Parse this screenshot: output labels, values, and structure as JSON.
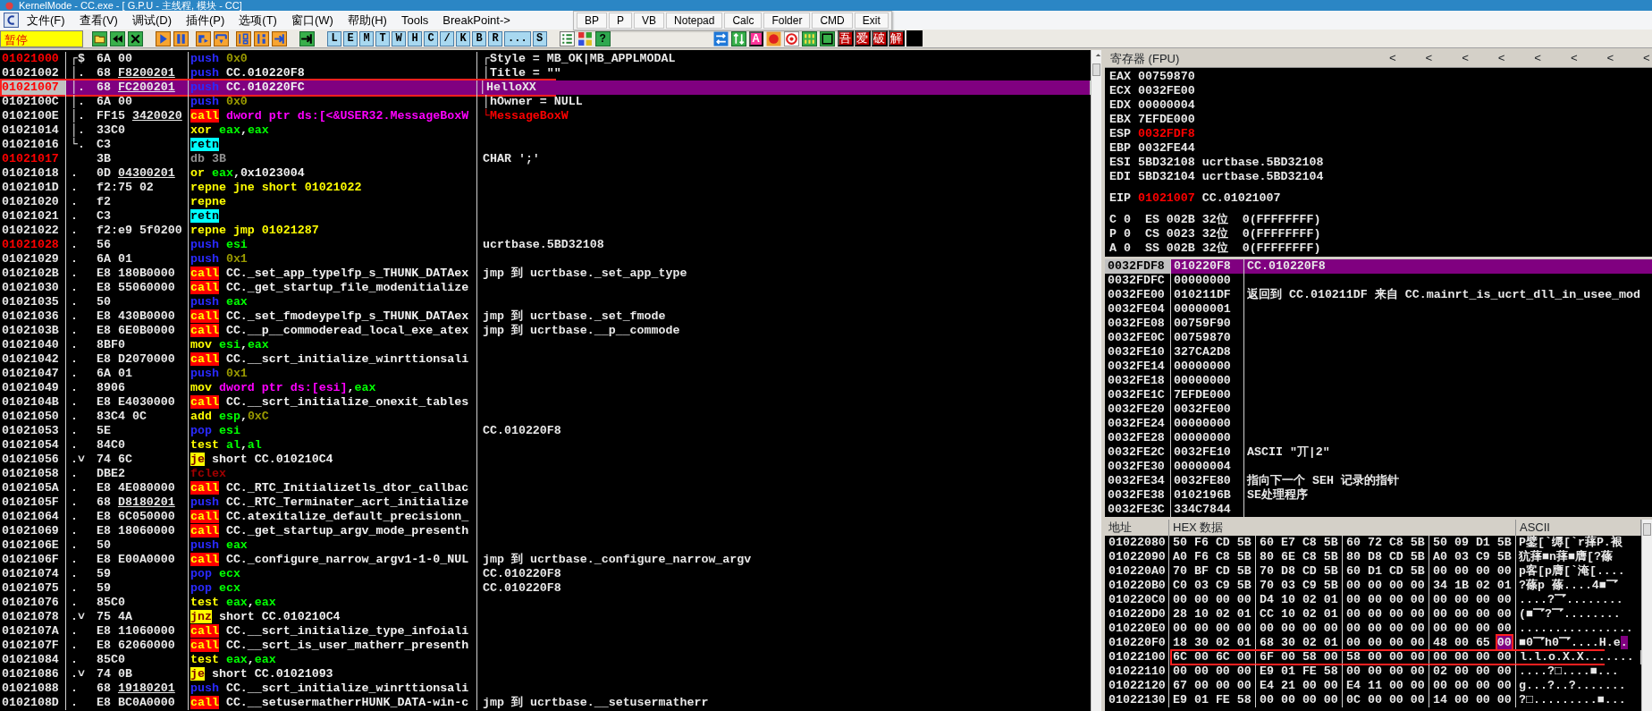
{
  "window": {
    "title": "KernelMode - CC.exe - [ G.P.U - 主线程, 模块 - CC]"
  },
  "menu": [
    "文件(F)",
    "查看(V)",
    "调试(D)",
    "插件(P)",
    "选项(T)",
    "窗口(W)",
    "帮助(H)",
    "Tools",
    "BreakPoint->"
  ],
  "quick_launch": [
    "BP",
    "P",
    "VB",
    "Notepad",
    "Calc",
    "Folder",
    "CMD",
    "Exit"
  ],
  "toolbar": {
    "status": "暂停",
    "letters": [
      "L",
      "E",
      "M",
      "T",
      "W",
      "H",
      "C",
      "/",
      "K",
      "B",
      "R",
      "...",
      "S"
    ],
    "help": "?",
    "font_button": "A",
    "brand": [
      "吾",
      "爱",
      "破",
      "解"
    ]
  },
  "disasm": {
    "rows": [
      {
        "address": "01021000",
        "target": true,
        "selected": false,
        "annotated": false,
        "mark": "┌$",
        "hex": "6A 00",
        "tokens": [
          {
            "kind": "push",
            "text": "push"
          },
          {
            "kind": "imm",
            "text": "0x0"
          }
        ],
        "comment": "┌Style = MB_OK|MB_APPLMODAL",
        "api": false
      },
      {
        "address": "01021002",
        "target": false,
        "selected": false,
        "annotated": false,
        "mark": "│.",
        "hex": "68",
        "fixup": "F8200201",
        "tokens": [
          {
            "kind": "push",
            "text": "push"
          },
          {
            "kind": "sym",
            "text": "CC.010220F8"
          }
        ],
        "comment": "│Title = \"\"",
        "api": false
      },
      {
        "address": "01021007",
        "target": true,
        "selected": true,
        "annotated": true,
        "mark": "│.",
        "hex": "68",
        "fixup": "FC200201",
        "tokens": [
          {
            "kind": "push",
            "text": "push"
          },
          {
            "kind": "sym",
            "text": "CC.010220FC"
          }
        ],
        "comment": "│HelloXX",
        "api": false
      },
      {
        "address": "0102100C",
        "target": false,
        "selected": false,
        "annotated": false,
        "mark": "│.",
        "hex": "6A 00",
        "tokens": [
          {
            "kind": "push",
            "text": "push"
          },
          {
            "kind": "imm",
            "text": "0x0"
          }
        ],
        "comment": "│hOwner = NULL",
        "api": false
      },
      {
        "address": "0102100E",
        "target": false,
        "selected": false,
        "annotated": false,
        "mark": "│.",
        "hex": "FF15",
        "fixup": "3420020",
        "tokens": [
          {
            "kind": "call",
            "text": "call"
          },
          {
            "kind": "mem",
            "text": "dword ptr ds:[<&USER32.MessageBoxW"
          }
        ],
        "comment": "└MessageBoxW",
        "api": true
      },
      {
        "address": "01021014",
        "target": false,
        "selected": false,
        "annotated": false,
        "mark": "│.",
        "hex": "33C0",
        "tokens": [
          {
            "kind": "op",
            "text": "xor"
          },
          {
            "kind": "reg",
            "text": "eax"
          },
          {
            "kind": "punct",
            "text": ","
          },
          {
            "kind": "reg",
            "text": "eax"
          }
        ]
      },
      {
        "address": "01021016",
        "target": false,
        "selected": false,
        "annotated": false,
        "mark": "└.",
        "hex": "C3",
        "tokens": [
          {
            "kind": "ret",
            "text": "retn"
          }
        ]
      },
      {
        "address": "01021017",
        "target": true,
        "selected": false,
        "annotated": false,
        "hex": "3B",
        "tokens": [
          {
            "kind": "db",
            "text": "db 3B"
          }
        ],
        "comment": "CHAR ';'",
        "api": false
      },
      {
        "address": "01021018",
        "target": false,
        "selected": false,
        "annotated": false,
        "mark": ".",
        "hex": "0D",
        "fixup": "04300201",
        "tokens": [
          {
            "kind": "op",
            "text": "or"
          },
          {
            "kind": "reg",
            "text": "eax"
          },
          {
            "kind": "sym",
            "text": ",0x1023004"
          }
        ]
      },
      {
        "address": "0102101D",
        "target": false,
        "selected": false,
        "annotated": false,
        "mark": ".",
        "hex": "f2:75 02",
        "tokens": [
          {
            "kind": "op",
            "text": "repne jne short 01021022"
          }
        ]
      },
      {
        "address": "01021020",
        "target": false,
        "selected": false,
        "annotated": false,
        "mark": ".",
        "hex": "f2",
        "tokens": [
          {
            "kind": "op",
            "text": "repne"
          }
        ]
      },
      {
        "address": "01021021",
        "target": false,
        "selected": false,
        "annotated": false,
        "mark": ".",
        "hex": "C3",
        "tokens": [
          {
            "kind": "ret",
            "text": "retn"
          }
        ]
      },
      {
        "address": "01021022",
        "target": false,
        "selected": false,
        "annotated": false,
        "mark": ".",
        "hex": "f2:e9 5f0200",
        "tokens": [
          {
            "kind": "op",
            "text": "repne jmp 01021287"
          }
        ]
      },
      {
        "address": "01021028",
        "target": true,
        "selected": false,
        "annotated": false,
        "mark": ".",
        "hex": "56",
        "tokens": [
          {
            "kind": "push",
            "text": "push"
          },
          {
            "kind": "reg",
            "text": "esi"
          }
        ],
        "comment": "ucrtbase.5BD32108",
        "api": false
      },
      {
        "address": "01021029",
        "target": false,
        "selected": false,
        "annotated": false,
        "mark": ".",
        "hex": "6A 01",
        "tokens": [
          {
            "kind": "push",
            "text": "push"
          },
          {
            "kind": "imm",
            "text": "0x1"
          }
        ]
      },
      {
        "address": "0102102B",
        "target": false,
        "selected": false,
        "annotated": false,
        "mark": ".",
        "hex": "E8 180B0000",
        "tokens": [
          {
            "kind": "call",
            "text": "call"
          },
          {
            "kind": "sym",
            "text": "CC._set_app_typelfp_s_THUNK_DATAex"
          }
        ],
        "comment": "jmp 到 ucrtbase._set_app_type",
        "api": false
      },
      {
        "address": "01021030",
        "target": false,
        "selected": false,
        "annotated": false,
        "mark": ".",
        "hex": "E8 55060000",
        "tokens": [
          {
            "kind": "call",
            "text": "call"
          },
          {
            "kind": "sym",
            "text": "CC._get_startup_file_modenitialize"
          }
        ]
      },
      {
        "address": "01021035",
        "target": false,
        "selected": false,
        "annotated": false,
        "mark": ".",
        "hex": "50",
        "tokens": [
          {
            "kind": "push",
            "text": "push"
          },
          {
            "kind": "reg",
            "text": "eax"
          }
        ]
      },
      {
        "address": "01021036",
        "target": false,
        "selected": false,
        "annotated": false,
        "mark": ".",
        "hex": "E8 430B0000",
        "tokens": [
          {
            "kind": "call",
            "text": "call"
          },
          {
            "kind": "sym",
            "text": "CC._set_fmodeypelfp_s_THUNK_DATAex"
          }
        ],
        "comment": "jmp 到 ucrtbase._set_fmode",
        "api": false
      },
      {
        "address": "0102103B",
        "target": false,
        "selected": false,
        "annotated": false,
        "mark": ".",
        "hex": "E8 6E0B0000",
        "tokens": [
          {
            "kind": "call",
            "text": "call"
          },
          {
            "kind": "sym",
            "text": "CC.__p__commoderead_local_exe_atex"
          }
        ],
        "comment": "jmp 到 ucrtbase.__p__commode",
        "api": false
      },
      {
        "address": "01021040",
        "target": false,
        "selected": false,
        "annotated": false,
        "mark": ".",
        "hex": "8BF0",
        "tokens": [
          {
            "kind": "op",
            "text": "mov"
          },
          {
            "kind": "reg",
            "text": "esi"
          },
          {
            "kind": "punct",
            "text": ","
          },
          {
            "kind": "reg",
            "text": "eax"
          }
        ]
      },
      {
        "address": "01021042",
        "target": false,
        "selected": false,
        "annotated": false,
        "mark": ".",
        "hex": "E8 D2070000",
        "tokens": [
          {
            "kind": "call",
            "text": "call"
          },
          {
            "kind": "sym",
            "text": "CC.__scrt_initialize_winrttionsali"
          }
        ]
      },
      {
        "address": "01021047",
        "target": false,
        "selected": false,
        "annotated": false,
        "mark": ".",
        "hex": "6A 01",
        "tokens": [
          {
            "kind": "push",
            "text": "push"
          },
          {
            "kind": "imm",
            "text": "0x1"
          }
        ]
      },
      {
        "address": "01021049",
        "target": false,
        "selected": false,
        "annotated": false,
        "mark": ".",
        "hex": "8906",
        "tokens": [
          {
            "kind": "op",
            "text": "mov"
          },
          {
            "kind": "mem",
            "text": "dword ptr ds:[esi]"
          },
          {
            "kind": "punct",
            "text": ","
          },
          {
            "kind": "reg",
            "text": "eax"
          }
        ]
      },
      {
        "address": "0102104B",
        "target": false,
        "selected": false,
        "annotated": false,
        "mark": ".",
        "hex": "E8 E4030000",
        "tokens": [
          {
            "kind": "call",
            "text": "call"
          },
          {
            "kind": "sym",
            "text": "CC.__scrt_initialize_onexit_tables"
          }
        ]
      },
      {
        "address": "01021050",
        "target": false,
        "selected": false,
        "annotated": false,
        "mark": ".",
        "hex": "83C4 0C",
        "tokens": [
          {
            "kind": "op",
            "text": "add"
          },
          {
            "kind": "reg",
            "text": "esp"
          },
          {
            "kind": "punct",
            "text": ","
          },
          {
            "kind": "imm",
            "text": "0xC"
          }
        ]
      },
      {
        "address": "01021053",
        "target": false,
        "selected": false,
        "annotated": false,
        "mark": ".",
        "hex": "5E",
        "tokens": [
          {
            "kind": "push",
            "text": "pop"
          },
          {
            "kind": "reg",
            "text": "esi"
          }
        ],
        "comment": "CC.010220F8",
        "api": false
      },
      {
        "address": "01021054",
        "target": false,
        "selected": false,
        "annotated": false,
        "mark": ".",
        "hex": "84C0",
        "tokens": [
          {
            "kind": "op",
            "text": "test"
          },
          {
            "kind": "reg",
            "text": "al"
          },
          {
            "kind": "punct",
            "text": ","
          },
          {
            "kind": "reg",
            "text": "al"
          }
        ]
      },
      {
        "address": "01021056",
        "target": false,
        "selected": false,
        "annotated": false,
        "mark": ".˅",
        "hex": "74 6C",
        "tokens": [
          {
            "kind": "jcc",
            "text": "je"
          },
          {
            "kind": "sym",
            "text": "short CC.010210C4"
          }
        ]
      },
      {
        "address": "01021058",
        "target": false,
        "selected": false,
        "annotated": false,
        "mark": ".",
        "hex": "DBE2",
        "tokens": [
          {
            "kind": "fpu",
            "text": "fclex"
          }
        ]
      },
      {
        "address": "0102105A",
        "target": false,
        "selected": false,
        "annotated": false,
        "mark": ".",
        "hex": "E8 4E080000",
        "tokens": [
          {
            "kind": "call",
            "text": "call"
          },
          {
            "kind": "sym",
            "text": "CC._RTC_Initializetls_dtor_callbac"
          }
        ]
      },
      {
        "address": "0102105F",
        "target": false,
        "selected": false,
        "annotated": false,
        "mark": ".",
        "hex": "68",
        "fixup": "D8180201",
        "tokens": [
          {
            "kind": "push",
            "text": "push"
          },
          {
            "kind": "sym",
            "text": "CC._RTC_Terminater_acrt_initialize"
          }
        ]
      },
      {
        "address": "01021064",
        "target": false,
        "selected": false,
        "annotated": false,
        "mark": ".",
        "hex": "E8 6C050000",
        "tokens": [
          {
            "kind": "call",
            "text": "call"
          },
          {
            "kind": "sym",
            "text": "CC.atexitalize_default_precisionn_"
          }
        ]
      },
      {
        "address": "01021069",
        "target": false,
        "selected": false,
        "annotated": false,
        "mark": ".",
        "hex": "E8 18060000",
        "tokens": [
          {
            "kind": "call",
            "text": "call"
          },
          {
            "kind": "sym",
            "text": "CC._get_startup_argv_mode_presenth"
          }
        ]
      },
      {
        "address": "0102106E",
        "target": false,
        "selected": false,
        "annotated": false,
        "mark": ".",
        "hex": "50",
        "tokens": [
          {
            "kind": "push",
            "text": "push"
          },
          {
            "kind": "reg",
            "text": "eax"
          }
        ]
      },
      {
        "address": "0102106F",
        "target": false,
        "selected": false,
        "annotated": false,
        "mark": ".",
        "hex": "E8 E00A0000",
        "tokens": [
          {
            "kind": "call",
            "text": "call"
          },
          {
            "kind": "sym",
            "text": "CC._configure_narrow_argv1-1-0_NUL"
          }
        ],
        "comment": "jmp 到 ucrtbase._configure_narrow_argv",
        "api": false
      },
      {
        "address": "01021074",
        "target": false,
        "selected": false,
        "annotated": false,
        "mark": ".",
        "hex": "59",
        "tokens": [
          {
            "kind": "push",
            "text": "pop"
          },
          {
            "kind": "reg",
            "text": "ecx"
          }
        ],
        "comment": "CC.010220F8",
        "api": false
      },
      {
        "address": "01021075",
        "target": false,
        "selected": false,
        "annotated": false,
        "mark": ".",
        "hex": "59",
        "tokens": [
          {
            "kind": "push",
            "text": "pop"
          },
          {
            "kind": "reg",
            "text": "ecx"
          }
        ],
        "comment": "CC.010220F8",
        "api": false
      },
      {
        "address": "01021076",
        "target": false,
        "selected": false,
        "annotated": false,
        "mark": ".",
        "hex": "85C0",
        "tokens": [
          {
            "kind": "op",
            "text": "test"
          },
          {
            "kind": "reg",
            "text": "eax"
          },
          {
            "kind": "punct",
            "text": ","
          },
          {
            "kind": "reg",
            "text": "eax"
          }
        ]
      },
      {
        "address": "01021078",
        "target": false,
        "selected": false,
        "annotated": false,
        "mark": ".˅",
        "hex": "75 4A",
        "tokens": [
          {
            "kind": "jcc",
            "text": "jnz"
          },
          {
            "kind": "sym",
            "text": "short CC.010210C4"
          }
        ]
      },
      {
        "address": "0102107A",
        "target": false,
        "selected": false,
        "annotated": false,
        "mark": ".",
        "hex": "E8 11060000",
        "tokens": [
          {
            "kind": "call",
            "text": "call"
          },
          {
            "kind": "sym",
            "text": "CC.__scrt_initialize_type_infoiali"
          }
        ]
      },
      {
        "address": "0102107F",
        "target": false,
        "selected": false,
        "annotated": false,
        "mark": ".",
        "hex": "E8 62060000",
        "tokens": [
          {
            "kind": "call",
            "text": "call"
          },
          {
            "kind": "sym",
            "text": "CC.__scrt_is_user_matherr_presenth"
          }
        ]
      },
      {
        "address": "01021084",
        "target": false,
        "selected": false,
        "annotated": false,
        "mark": ".",
        "hex": "85C0",
        "tokens": [
          {
            "kind": "op",
            "text": "test"
          },
          {
            "kind": "reg",
            "text": "eax"
          },
          {
            "kind": "punct",
            "text": ","
          },
          {
            "kind": "reg",
            "text": "eax"
          }
        ]
      },
      {
        "address": "01021086",
        "target": false,
        "selected": false,
        "annotated": false,
        "mark": ".˅",
        "hex": "74 0B",
        "tokens": [
          {
            "kind": "jcc",
            "text": "je"
          },
          {
            "kind": "sym",
            "text": "short CC.01021093"
          }
        ]
      },
      {
        "address": "01021088",
        "target": false,
        "selected": false,
        "annotated": false,
        "mark": ".",
        "hex": "68",
        "fixup": "19180201",
        "tokens": [
          {
            "kind": "push",
            "text": "push"
          },
          {
            "kind": "sym",
            "text": "CC.__scrt_initialize_winrttionsali"
          }
        ]
      },
      {
        "address": "0102108D",
        "target": false,
        "selected": false,
        "annotated": false,
        "mark": ".",
        "hex": "E8 BC0A0000",
        "tokens": [
          {
            "kind": "call",
            "text": "call"
          },
          {
            "kind": "sym",
            "text": "CC.__setusermatherrHUNK_DATA-win-c"
          }
        ],
        "comment": "jmp 到 ucrtbase.__setusermatherr",
        "api": false
      }
    ]
  },
  "registers": {
    "title": "寄存器 (FPU)",
    "arrows": [
      "<",
      "<",
      "<",
      "<",
      "<",
      "<",
      "<",
      "<"
    ],
    "general": [
      {
        "name": "EAX",
        "value": "00759870",
        "changed": false
      },
      {
        "name": "ECX",
        "value": "0032FE00",
        "changed": false
      },
      {
        "name": "EDX",
        "value": "00000004",
        "changed": false
      },
      {
        "name": "EBX",
        "value": "7EFDE000",
        "changed": false
      },
      {
        "name": "ESP",
        "value": "0032FDF8",
        "changed": true
      },
      {
        "name": "EBP",
        "value": "0032FE44",
        "changed": false
      },
      {
        "name": "ESI",
        "value": "5BD32108",
        "changed": false,
        "comment": "ucrtbase.5BD32108"
      },
      {
        "name": "EDI",
        "value": "5BD32104",
        "changed": false,
        "comment": "ucrtbase.5BD32104"
      }
    ],
    "eip": {
      "name": "EIP",
      "value": "01021007",
      "changed": true,
      "comment": "CC.01021007"
    },
    "segments": [
      "C 0  ES 002B 32位  0(FFFFFFFF)",
      "P 0  CS 0023 32位  0(FFFFFFFF)",
      "A 0  SS 002B 32位  0(FFFFFFFF)"
    ]
  },
  "stack": [
    {
      "address": "0032FDF8",
      "value": "010220F8",
      "comment": "CC.010220F8",
      "selected": true
    },
    {
      "address": "0032FDFC",
      "value": "00000000",
      "selected": false
    },
    {
      "address": "0032FE00",
      "value": "010211DF",
      "comment": "返回到 CC.010211DF 来自 CC.mainrt_is_ucrt_dll_in_usee_mod",
      "selected": false
    },
    {
      "address": "0032FE04",
      "value": "00000001",
      "selected": false
    },
    {
      "address": "0032FE08",
      "value": "00759F90",
      "selected": false
    },
    {
      "address": "0032FE0C",
      "value": "00759870",
      "selected": false
    },
    {
      "address": "0032FE10",
      "value": "327CA2D8",
      "selected": false
    },
    {
      "address": "0032FE14",
      "value": "00000000",
      "selected": false
    },
    {
      "address": "0032FE18",
      "value": "00000000",
      "selected": false
    },
    {
      "address": "0032FE1C",
      "value": "7EFDE000",
      "selected": false
    },
    {
      "address": "0032FE20",
      "value": "0032FE00",
      "selected": false
    },
    {
      "address": "0032FE24",
      "value": "00000000",
      "selected": false
    },
    {
      "address": "0032FE28",
      "value": "00000000",
      "selected": false
    },
    {
      "address": "0032FE2C",
      "value": "0032FE10",
      "comment": "ASCII \"丌|2\"",
      "selected": false
    },
    {
      "address": "0032FE30",
      "value": "00000004",
      "selected": false
    },
    {
      "address": "0032FE34",
      "value": "0032FE80",
      "comment": "指向下一个 SEH 记录的指针",
      "selected": false
    },
    {
      "address": "0032FE38",
      "value": "0102196B",
      "comment": "SE处理程序",
      "selected": false
    },
    {
      "address": "0032FE3C",
      "value": "334C7844",
      "selected": false
    }
  ],
  "dump": {
    "columns": [
      "地址",
      "HEX 数据",
      "ASCII"
    ],
    "rows": [
      {
        "address": "01022080",
        "groups": [
          "50 F6 CD 5B",
          "60 E7 C8 5B",
          "60 72 C8 5B",
          "50 09 D1 5B"
        ],
        "ascii": "P鐾[`缛[`r萚P.裉",
        "annotated": false
      },
      {
        "address": "01022090",
        "groups": [
          "A0 F6 C8 5B",
          "80 6E C8 5B",
          "80 D8 CD 5B",
          "A0 03 C9 5B"
        ],
        "ascii": "犺萚■n萚■膺[?蓧",
        "annotated": false
      },
      {
        "address": "010220A0",
        "groups": [
          "70 BF CD 5B",
          "70 D8 CD 5B",
          "60 D1 CD 5B",
          "00 00 00 00"
        ],
        "ascii": "p客[p膺[`淹[....",
        "annotated": false
      },
      {
        "address": "010220B0",
        "groups": [
          "C0 03 C9 5B",
          "70 03 C9 5B",
          "00 00 00 00",
          "34 1B 02 01"
        ],
        "ascii": "?蓧p 蓧....4■乛",
        "annotated": false
      },
      {
        "address": "010220C0",
        "groups": [
          "00 00 00 00",
          "D4 10 02 01",
          "00 00 00 00",
          "00 00 00 00"
        ],
        "ascii": "....?乛........",
        "annotated": false
      },
      {
        "address": "010220D0",
        "groups": [
          "28 10 02 01",
          "CC 10 02 01",
          "00 00 00 00",
          "00 00 00 00"
        ],
        "ascii": "(■乛?乛........",
        "annotated": false
      },
      {
        "address": "010220E0",
        "groups": [
          "00 00 00 00",
          "00 00 00 00",
          "00 00 00 00",
          "00 00 00 00"
        ],
        "ascii": "................",
        "annotated": false
      },
      {
        "address": "010220F0",
        "groups": [
          "18 30 02 01",
          "68 30 02 01",
          "00 00 00 00",
          "48 00 65"
        ],
        "cursor_byte": "00",
        "ascii": "■0乛h0乛....H.e",
        "cursor_char": ".",
        "cursor_annotated": true,
        "annotated": false
      },
      {
        "address": "01022100",
        "groups": [
          "6C 00 6C 00",
          "6F 00 58 00",
          "58 00 00 00",
          "00 00 00 00"
        ],
        "ascii": "l.l.o.X.X.......",
        "annotated": true
      },
      {
        "address": "01022110",
        "groups": [
          "00 00 00 00",
          "E9 01 FE 58",
          "00 00 00 00",
          "02 00 00 00"
        ],
        "ascii": "....?□....■...",
        "annotated": false
      },
      {
        "address": "01022120",
        "groups": [
          "67 00 00 00",
          "E4 21 00 00",
          "E4 11 00 00",
          "00 00 00 00"
        ],
        "ascii": "g...?..?.......",
        "annotated": false
      },
      {
        "address": "01022130",
        "groups": [
          "E9 01 FE 58",
          "00 00 00 00",
          "0C 00 00 00",
          "14 00 00 00"
        ],
        "ascii": "?□.........■...",
        "annotated": false
      }
    ]
  }
}
